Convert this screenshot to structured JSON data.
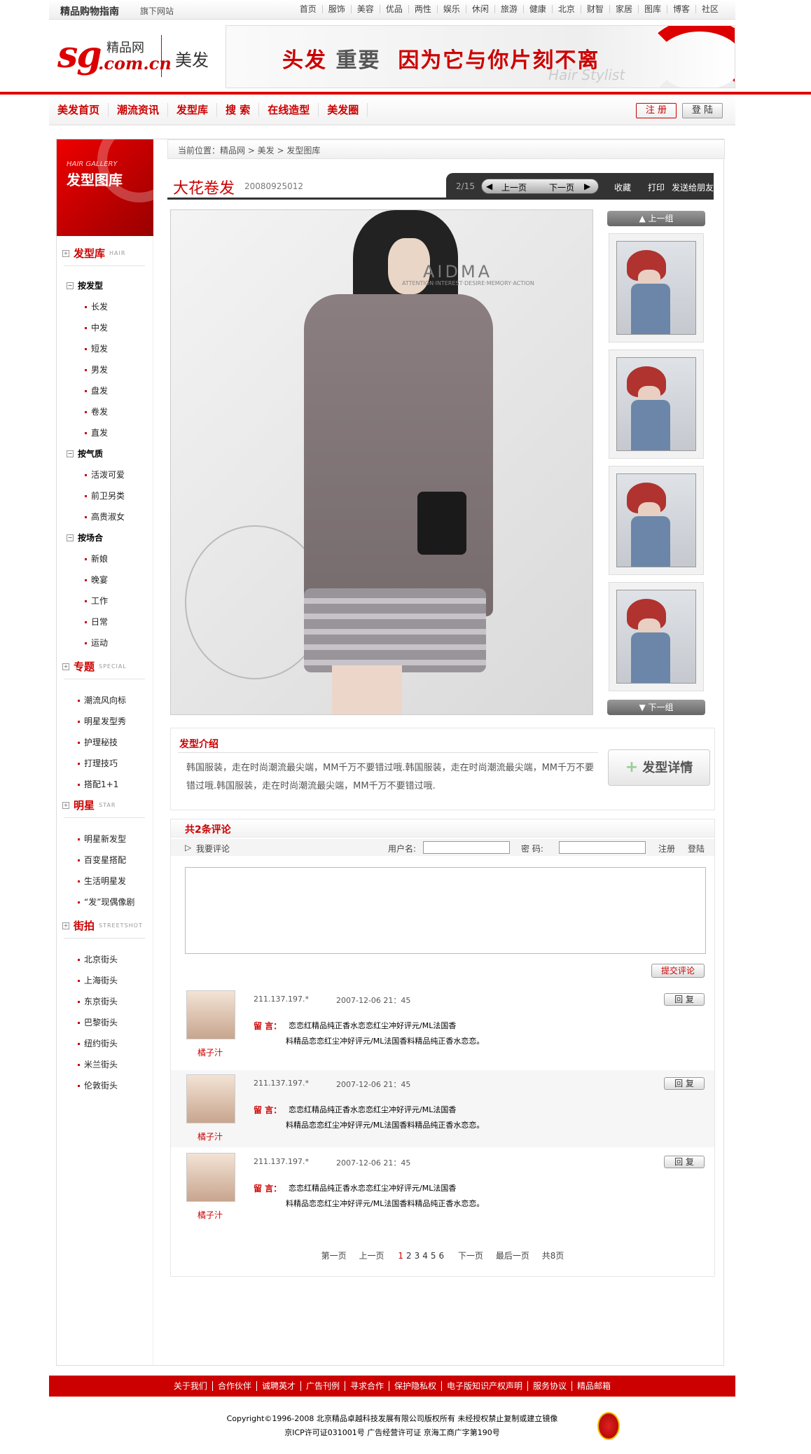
{
  "topbar": {
    "logo": "精品购物指南",
    "sub": "旗下网站",
    "nav": [
      "首页",
      "服饰",
      "美容",
      "优品",
      "两性",
      "娱乐",
      "休闲",
      "旅游",
      "健康",
      "北京",
      "财智",
      "家居",
      "图库",
      "博客",
      "社区"
    ]
  },
  "header": {
    "logo_mark": "sg",
    "logo_domain": ".com.cn",
    "logo_name": "精品网",
    "section": "美发",
    "banner_slogan_a": "头发",
    "banner_slogan_b": "重要",
    "banner_slogan_c": "因为它与你片刻不离",
    "banner_sub": "Hair Stylist"
  },
  "mainnav": {
    "items": [
      "美发首页",
      "潮流资讯",
      "发型库",
      "搜 索",
      "在线造型",
      "美发圈"
    ],
    "register": "注 册",
    "login": "登 陆"
  },
  "sidebar": {
    "head_en": "HAIR GALLERY",
    "head_cn": "发型图库",
    "cat1": {
      "title": "发型库",
      "en": "HAIR"
    },
    "grp1": "按发型",
    "grp1_items": [
      "长发",
      "中发",
      "短发",
      "男发",
      "盘发",
      "卷发",
      "直发"
    ],
    "grp2": "按气质",
    "grp2_items": [
      "活泼可爱",
      "前卫另类",
      "高贵淑女"
    ],
    "grp3": "按场合",
    "grp3_items": [
      "新娘",
      "晚宴",
      "工作",
      "日常",
      "运动"
    ],
    "cat2": {
      "title": "专题",
      "en": "SPECIAL"
    },
    "cat2_items": [
      "潮流风向标",
      "明星发型秀",
      "护理秘技",
      "打理技巧",
      "搭配1+1"
    ],
    "cat3": {
      "title": "明星",
      "en": "STAR"
    },
    "cat3_items": [
      "明星新发型",
      "百变星搭配",
      "生活明星发",
      "“发”现偶像剧"
    ],
    "cat4": {
      "title": "街拍",
      "en": "STREETSHOT"
    },
    "cat4_items": [
      "北京街头",
      "上海街头",
      "东京街头",
      "巴黎街头",
      "纽约街头",
      "米兰街头",
      "伦敦街头"
    ]
  },
  "crumb": "当前位置：精品网 > 美发 > 发型图库",
  "gallery": {
    "title": "大花卷发",
    "code": "20080925012",
    "page": "2/15",
    "prev": "上一页",
    "next": "下一页",
    "actions": [
      "收藏",
      "打印",
      "发送给朋友"
    ],
    "photo_brand": "AIDMA",
    "photo_tag": "ATTENTION·INTEREST·DESIRE·MEMORY·ACTION",
    "prev_group": "上一组",
    "next_group": "下一组"
  },
  "intro": {
    "heading": "发型介绍",
    "text": "韩国服装，走在时尚潮流最尖端，MM千万不要错过哦.韩国服装，走在时尚潮流最尖端，MM千万不要错过哦.韩国服装，走在时尚潮流最尖端，MM千万不要错过哦.",
    "detail_button": "发型详情"
  },
  "comments": {
    "heading": "共2条评论",
    "my_comment": "我要评论",
    "username_label": "用户名:",
    "password_label": "密 码:",
    "register": "注册",
    "login": "登陆",
    "submit": "提交评论",
    "list": [
      {
        "user": "橘子汁",
        "ip": "211.137.197.*",
        "date": "2007-12-06 21：45",
        "reply": "回 复",
        "label": "留 言：",
        "line1": "恋恋红精品纯正香水恋恋红尘冲好评元/ML法国香",
        "line2": "料精品恋恋红尘冲好评元/ML法国香料精品纯正香水恋恋。"
      },
      {
        "user": "橘子汁",
        "ip": "211.137.197.*",
        "date": "2007-12-06 21：45",
        "reply": "回 复",
        "label": "留 言：",
        "line1": "恋恋红精品纯正香水恋恋红尘冲好评元/ML法国香",
        "line2": "料精品恋恋红尘冲好评元/ML法国香料精品纯正香水恋恋。"
      },
      {
        "user": "橘子汁",
        "ip": "211.137.197.*",
        "date": "2007-12-06 21：45",
        "reply": "回 复",
        "label": "留 言：",
        "line1": "恋恋红精品纯正香水恋恋红尘冲好评元/ML法国香",
        "line2": "料精品恋恋红尘冲好评元/ML法国香料精品纯正香水恋恋。"
      }
    ]
  },
  "pager": {
    "first": "第一页",
    "prev": "上一页",
    "pages": [
      "1",
      "2",
      "3",
      "4",
      "5",
      "6"
    ],
    "current": "1",
    "next": "下一页",
    "last": "最后一页",
    "total": "共8页"
  },
  "footer": {
    "links": [
      "关于我们",
      "合作伙伴",
      "诚聘英才",
      "广告刊例",
      "寻求合作",
      "保护隐私权",
      "电子版知识产权声明",
      "服务协议",
      "精品邮箱"
    ],
    "copy1": "Copyright©1996-2008 北京精品卓越科技发展有限公司版权所有 未经授权禁止复制或建立镜像",
    "copy2": "京ICP许可证031001号  广告经营许可证 京海工商广字第190号"
  }
}
